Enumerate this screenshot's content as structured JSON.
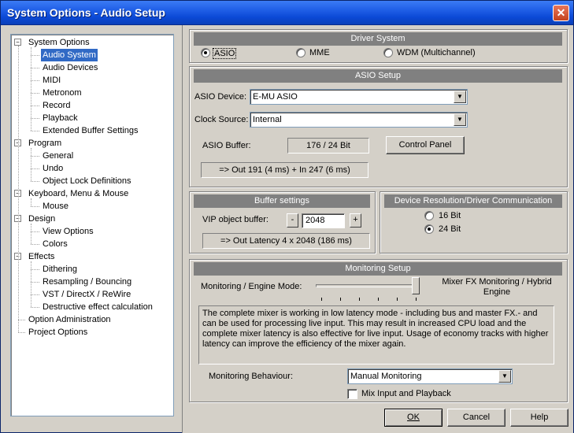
{
  "window": {
    "title": "System Options - Audio Setup",
    "close_label": "✕"
  },
  "tree": {
    "items": [
      {
        "label": "System Options",
        "level": 0,
        "expander": "−"
      },
      {
        "label": "Audio System",
        "level": 1,
        "selected": true
      },
      {
        "label": "Audio Devices",
        "level": 1
      },
      {
        "label": "MIDI",
        "level": 1
      },
      {
        "label": "Metronom",
        "level": 1
      },
      {
        "label": "Record",
        "level": 1
      },
      {
        "label": "Playback",
        "level": 1
      },
      {
        "label": "Extended Buffer Settings",
        "level": 1
      },
      {
        "label": "Program",
        "level": 0,
        "expander": "−"
      },
      {
        "label": "General",
        "level": 1
      },
      {
        "label": "Undo",
        "level": 1
      },
      {
        "label": "Object Lock Definitions",
        "level": 1
      },
      {
        "label": "Keyboard, Menu & Mouse",
        "level": 0,
        "expander": "−"
      },
      {
        "label": "Mouse",
        "level": 1
      },
      {
        "label": "Design",
        "level": 0,
        "expander": "−"
      },
      {
        "label": "View Options",
        "level": 1
      },
      {
        "label": "Colors",
        "level": 1
      },
      {
        "label": "Effects",
        "level": 0,
        "expander": "−"
      },
      {
        "label": "Dithering",
        "level": 1
      },
      {
        "label": "Resampling / Bouncing",
        "level": 1
      },
      {
        "label": "VST / DirectX / ReWire",
        "level": 1
      },
      {
        "label": "Destructive effect calculation",
        "level": 1
      },
      {
        "label": "Option Administration",
        "level": 0
      },
      {
        "label": "Project Options",
        "level": 0
      }
    ]
  },
  "driver_system": {
    "title": "Driver System",
    "options": [
      {
        "label": "ASIO",
        "checked": true
      },
      {
        "label": "MME",
        "checked": false
      },
      {
        "label": "WDM (Multichannel)",
        "checked": false
      }
    ]
  },
  "asio_setup": {
    "title": "ASIO Setup",
    "device_label": "ASIO Device:",
    "device_value": "E-MU ASIO",
    "clock_label": "Clock Source:",
    "clock_value": "Internal",
    "buffer_label": "ASIO Buffer:",
    "buffer_value": "176 / 24 Bit",
    "control_panel_label": "Control Panel",
    "latency_text": "=> Out 191 (4 ms) + In 247 (6 ms)"
  },
  "buffer_settings": {
    "title": "Buffer settings",
    "vip_label": "VIP object buffer:",
    "minus_label": "-",
    "plus_label": "+",
    "vip_value": "2048",
    "latency_text": "=> Out Latency 4 x 2048 (186 ms)"
  },
  "device_resolution": {
    "title": "Device Resolution/Driver Communication",
    "options": [
      {
        "label": "16 Bit",
        "checked": false
      },
      {
        "label": "24 Bit",
        "checked": true
      }
    ]
  },
  "monitoring": {
    "title": "Monitoring Setup",
    "mode_label": "Monitoring / Engine Mode:",
    "mode_value": "Mixer FX Monitoring / Hybrid Engine",
    "slider_position": 1.0,
    "description": "The complete mixer is working in low latency mode - including bus and master FX.- and can be used for processing live input.  This may result in increased CPU load and the complete mixer latency is also effective for live input. Usage of economy tracks with higher latency can improve the efficiency of the mixer again.",
    "behaviour_label": "Monitoring Behaviour:",
    "behaviour_value": "Manual Monitoring",
    "mix_label": "Mix Input and Playback",
    "mix_checked": false
  },
  "buttons": {
    "ok": "OK",
    "cancel": "Cancel",
    "help": "Help"
  },
  "colors": {
    "title_bar": "#0b49d6",
    "selection": "#316ac5",
    "group_header": "#808080"
  }
}
